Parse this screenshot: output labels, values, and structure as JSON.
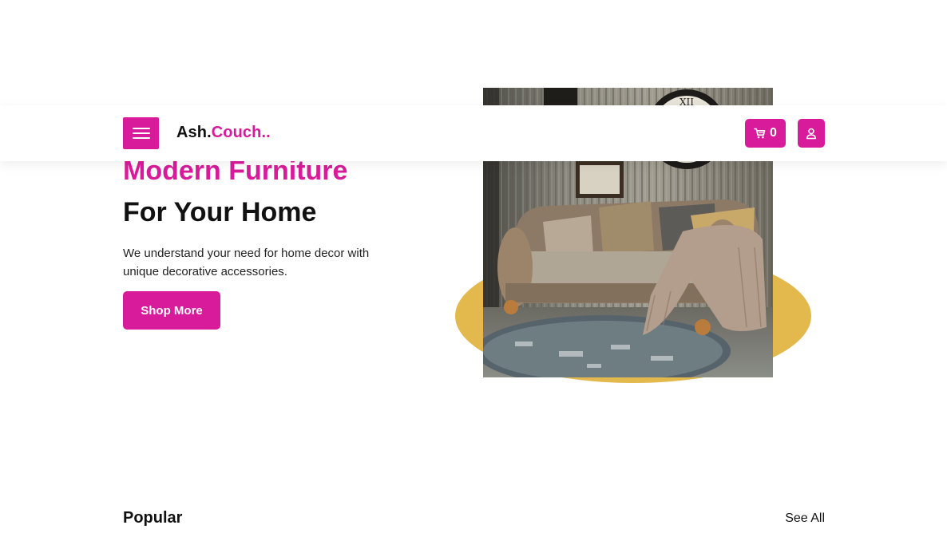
{
  "header": {
    "brand_main": "Ash.",
    "brand_accent": "Couch..",
    "cart_count": "0"
  },
  "hero": {
    "title_line_1": "Modern Furniture",
    "title_line_2": "For Your Home",
    "description": "We understand your need for home decor with unique decorative accessories.",
    "cta_label": "Shop More"
  },
  "popular": {
    "title": "Popular",
    "see_all_label": "See All"
  },
  "colors": {
    "accent": "#d81b9a",
    "blob": "#e3b84c",
    "text": "#111111"
  },
  "icons": {
    "menu": "hamburger-icon",
    "cart": "cart-icon",
    "user": "user-icon"
  }
}
